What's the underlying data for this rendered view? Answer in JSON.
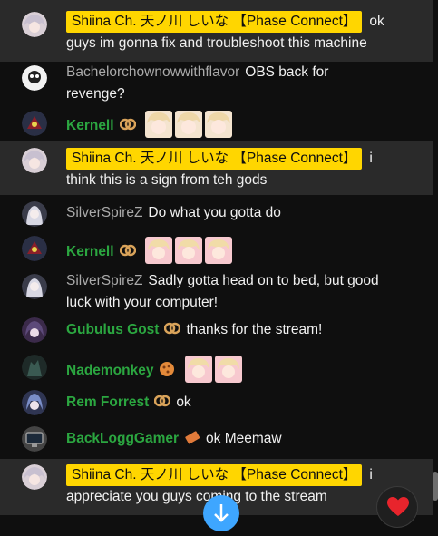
{
  "messages": [
    {
      "author": "Shiina Ch. 天ノ川 しいな 【Phase Connect】",
      "owner": true,
      "text_first": "ok",
      "text_rest": "guys im gonna fix and troubleshoot this machine",
      "avatar": "anime-avatar-light",
      "emojis": []
    },
    {
      "author": "Bachelorchownowwithflavor",
      "owner": false,
      "text_first": "OBS back for",
      "text_rest": "revenge?",
      "avatar": "cartoon-avatar",
      "emojis": []
    },
    {
      "author": "Kernell",
      "owner": false,
      "member": true,
      "badge": "pretzel-badge-icon",
      "text": "",
      "avatar": "mecha-avatar",
      "emojis": [
        "chibi-emote",
        "chibi-emote",
        "chibi-emote"
      ]
    },
    {
      "author": "Shiina Ch. 天ノ川 しいな 【Phase Connect】",
      "owner": true,
      "text_first": "i",
      "text_rest": "think this is a sign from teh gods",
      "avatar": "anime-avatar-light",
      "emojis": []
    },
    {
      "author": "SilverSpireZ",
      "owner": false,
      "text": "Do what you gotta do",
      "avatar": "silver-avatar",
      "emojis": []
    },
    {
      "author": "Kernell",
      "owner": false,
      "member": true,
      "badge": "pretzel-badge-icon",
      "text": "",
      "avatar": "mecha-avatar",
      "emojis": [
        "pink-chibi-emote",
        "pink-chibi-emote",
        "pink-chibi-emote"
      ]
    },
    {
      "author": "SilverSpireZ",
      "owner": false,
      "text_first": "Sadly gotta head on to bed, but good",
      "text_rest": "luck with your computer!",
      "avatar": "silver-avatar",
      "emojis": []
    },
    {
      "author": "Gubulus Gost",
      "owner": false,
      "member": true,
      "badge": "pretzel-badge-icon",
      "text": "thanks for the stream!",
      "avatar": "purple-avatar",
      "emojis": []
    },
    {
      "author": "Nademonkey",
      "owner": false,
      "member": true,
      "badge": "cookie-badge-icon",
      "text": "",
      "avatar": "dark-avatar",
      "emojis": [
        "pink-chibi-emote",
        "pink-chibi-emote"
      ]
    },
    {
      "author": "Rem Forrest",
      "owner": false,
      "member": true,
      "badge": "pretzel-badge-icon",
      "text": "ok",
      "avatar": "blue-avatar",
      "emojis": []
    },
    {
      "author": "BackLoggGamer",
      "owner": false,
      "member": true,
      "badge": "ticket-badge-icon",
      "text": "ok Meemaw",
      "avatar": "monitor-avatar",
      "emojis": []
    },
    {
      "author": "Shiina Ch. 天ノ川 しいな 【Phase Connect】",
      "owner": true,
      "text_first": "i",
      "text_rest": "appreciate you guys coming to the stream",
      "avatar": "anime-avatar-light",
      "emojis": []
    }
  ],
  "colors": {
    "owner_chip": "#ffd600",
    "member_name": "#2ba640",
    "highlight_row": "#2a2a2a",
    "background": "#0f0f0f"
  }
}
